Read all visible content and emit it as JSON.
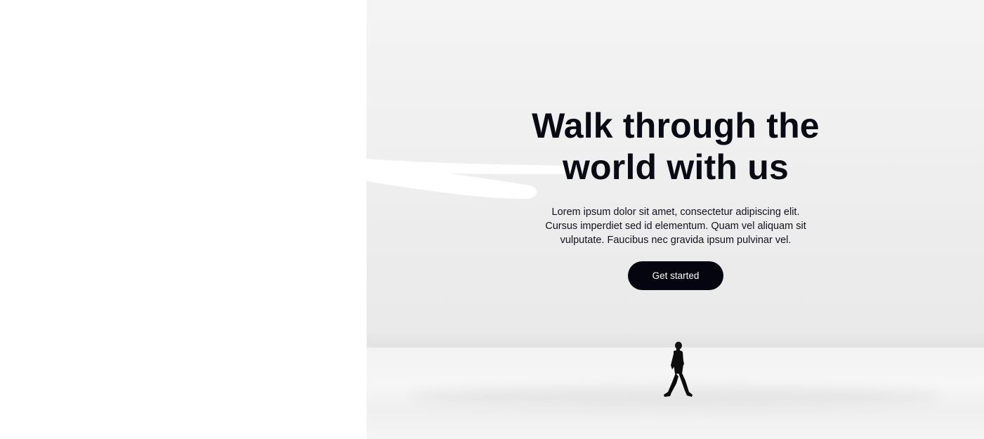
{
  "hero": {
    "headline_line1": "Walk through the",
    "headline_line2": "world with us",
    "description": "Lorem ipsum dolor sit amet, consectetur adipiscing elit. Cursus imperdiet sed id elementum. Quam vel aliquam sit vulputate. Faucibus nec gravida ipsum pulvinar vel.",
    "cta_label": "Get started"
  },
  "colors": {
    "text": "#0a0a14",
    "button_bg": "#05050f",
    "button_text": "#ffffff",
    "left_panel_bg": "#ffffff"
  },
  "icons": {
    "brush_stroke": "white-brush-stroke",
    "walker": "walking-person-silhouette"
  }
}
